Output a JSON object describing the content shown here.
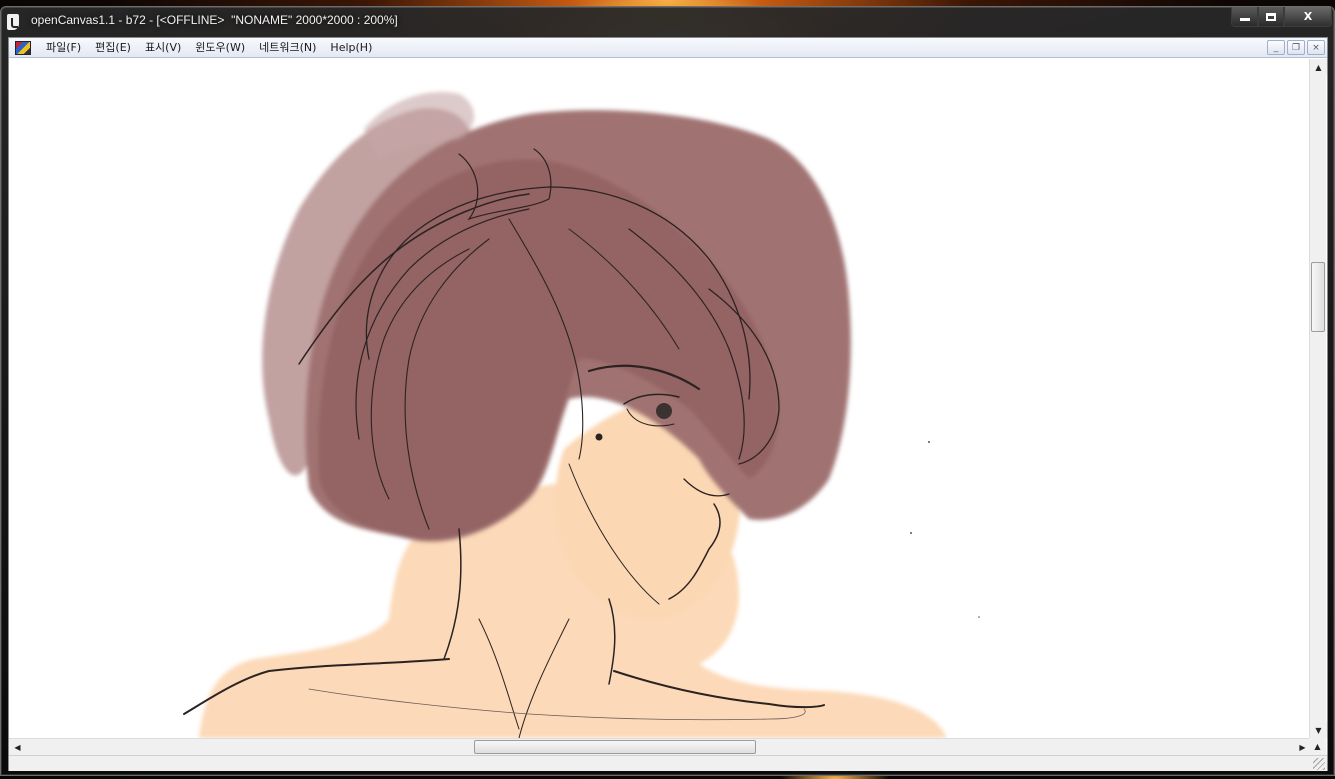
{
  "window": {
    "title": "openCanvas1.1 - b72 - [<OFFLINE>  \"NONAME\" 2000*2000 : 200%]",
    "buttons": {
      "minimize_icon": "minimize-icon",
      "maximize_icon": "maximize-icon",
      "close_label": "X"
    }
  },
  "menubar": {
    "items": [
      {
        "label": "파일(F)"
      },
      {
        "label": "편집(E)"
      },
      {
        "label": "표시(V)"
      },
      {
        "label": "윈도우(W)"
      },
      {
        "label": "네트워크(N)"
      },
      {
        "label": "Help(H)"
      }
    ],
    "child_buttons": {
      "minimize": "_",
      "restore": "❐",
      "close": "×"
    }
  },
  "canvas": {
    "document_name": "NONAME",
    "size": "2000*2000",
    "zoom": "200%",
    "mode": "<OFFLINE>",
    "colors": {
      "hair": "#9c6b6a",
      "skin": "#fcd9b8",
      "line": "#2b2322",
      "background": "#ffffff"
    }
  },
  "scrollbars": {
    "vertical": {
      "up_icon": "arrow-up-icon",
      "down_icon": "arrow-down-icon",
      "position": 0.3
    },
    "horizontal": {
      "left_icon": "arrow-left-icon",
      "right_icon": "arrow-right-icon",
      "position": 0.36
    }
  }
}
